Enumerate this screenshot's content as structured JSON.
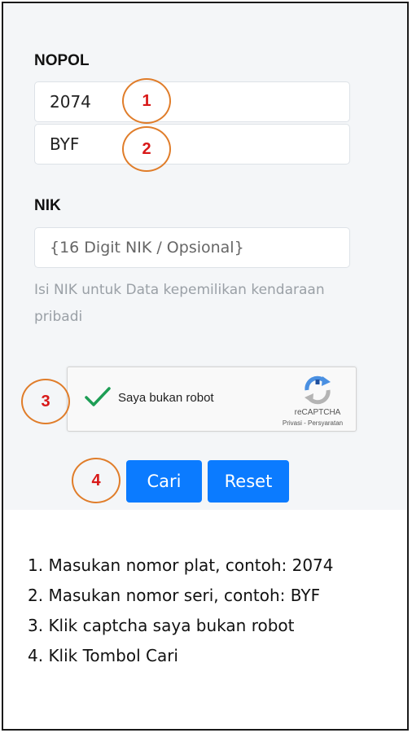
{
  "form": {
    "nopol_label": "NOPOL",
    "nopol_number_value": "2074",
    "nopol_series_value": "BYF",
    "nik_label": "NIK",
    "nik_placeholder": "{16 Digit NIK / Opsional}",
    "nik_help_line1": "Isi NIK untuk Data kepemilikan kendaraan",
    "nik_help_line2": "pribadi"
  },
  "captcha": {
    "checked": true,
    "label": "Saya bukan robot",
    "brand": "reCAPTCHA",
    "links": "Privasi - Persyaratan"
  },
  "buttons": {
    "search_label": "Cari",
    "reset_label": "Reset"
  },
  "callouts": [
    "1",
    "2",
    "3",
    "4"
  ],
  "instructions": [
    "1. Masukan nomor plat, contoh: 2074",
    "2. Masukan nomor seri, contoh: BYF",
    "3. Klik captcha saya bukan robot",
    "4. Klik Tombol Cari"
  ],
  "colors": {
    "button_blue": "#0b7bff",
    "callout_border": "#e07d2a",
    "callout_text": "#d81818",
    "check_green": "#1e9e55"
  }
}
